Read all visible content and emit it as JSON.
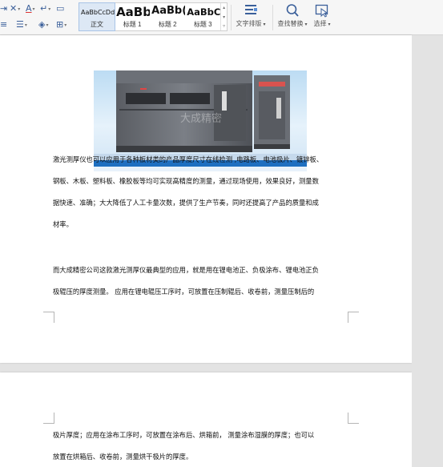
{
  "ribbon": {
    "styles": [
      {
        "preview": "AaBbCcDd",
        "label": "正文",
        "selected": true
      },
      {
        "preview": "AaBb",
        "label": "标题 1",
        "selected": false
      },
      {
        "preview": "AaBb(",
        "label": "标题 2",
        "selected": false
      },
      {
        "preview": "AaBbC(",
        "label": "标题 3",
        "selected": false
      }
    ],
    "layout_label": "文字排版",
    "find_label": "查找替换",
    "select_label": "选择",
    "icons": {
      "layout": "text-layout-icon",
      "find": "magnifier-icon",
      "select": "cursor-select-icon"
    }
  },
  "image": {
    "watermark": "大成精密"
  },
  "page1": {
    "paragraph1_lines": [
      "激光测厚仪也可以应用于各种板材类的产品厚度尺寸在线检测 ,电路板、电池极片、镀锌板、",
      "钢板、木板、塑料板、橡胶板等均可实现高精度的测量，通过现场使用，效果良好，测量数",
      "据快速、准确；大大降低了人工卡量次数，提供了生产节奏，同时还提高了产品的质量和成",
      "材率。"
    ],
    "paragraph2_lines": [
      "而大成精密公司这款激光测厚仪最典型的应用，就是用在锂电池正、负极涂布、锂电池正负",
      "极辊压的厚度测量。  应用在锂电辊压工序时，可放置在压制辊后、收卷前，测量压制后的"
    ]
  },
  "page2": {
    "paragraph_lines": [
      "极片厚度；应用在涂布工序时，可放置在涂布后、烘箱前，  测量涂布湿膜的厚度；也可以",
      "放置在烘箱后、收卷前，测量烘干极片的厚度。"
    ]
  },
  "colors": {
    "accent": "#3a5f9a",
    "page_bg": "#ffffff",
    "workspace": "#e3e3e3"
  }
}
